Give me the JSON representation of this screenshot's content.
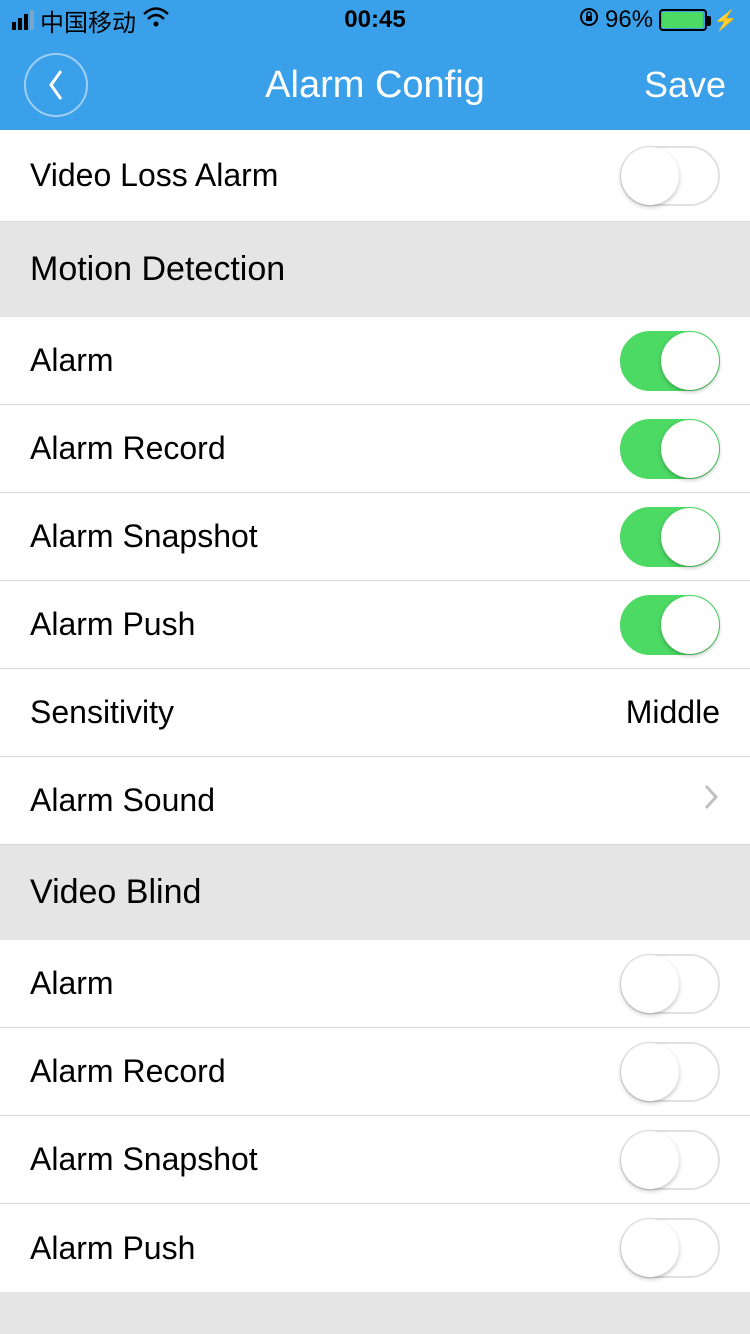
{
  "status": {
    "carrier": "中国移动",
    "time": "00:45",
    "battery_pct": "96%"
  },
  "nav": {
    "title": "Alarm Config",
    "save": "Save"
  },
  "rows": {
    "video_loss": {
      "label": "Video Loss Alarm",
      "on": false
    }
  },
  "motion": {
    "header": "Motion Detection",
    "alarm": {
      "label": "Alarm",
      "on": true
    },
    "record": {
      "label": "Alarm Record",
      "on": true
    },
    "snapshot": {
      "label": "Alarm Snapshot",
      "on": true
    },
    "push": {
      "label": "Alarm Push",
      "on": true
    },
    "sensitivity": {
      "label": "Sensitivity",
      "value": "Middle"
    },
    "sound": {
      "label": "Alarm Sound"
    }
  },
  "blind": {
    "header": "Video Blind",
    "alarm": {
      "label": "Alarm",
      "on": false
    },
    "record": {
      "label": "Alarm Record",
      "on": false
    },
    "snapshot": {
      "label": "Alarm Snapshot",
      "on": false
    },
    "push": {
      "label": "Alarm Push",
      "on": false
    }
  }
}
